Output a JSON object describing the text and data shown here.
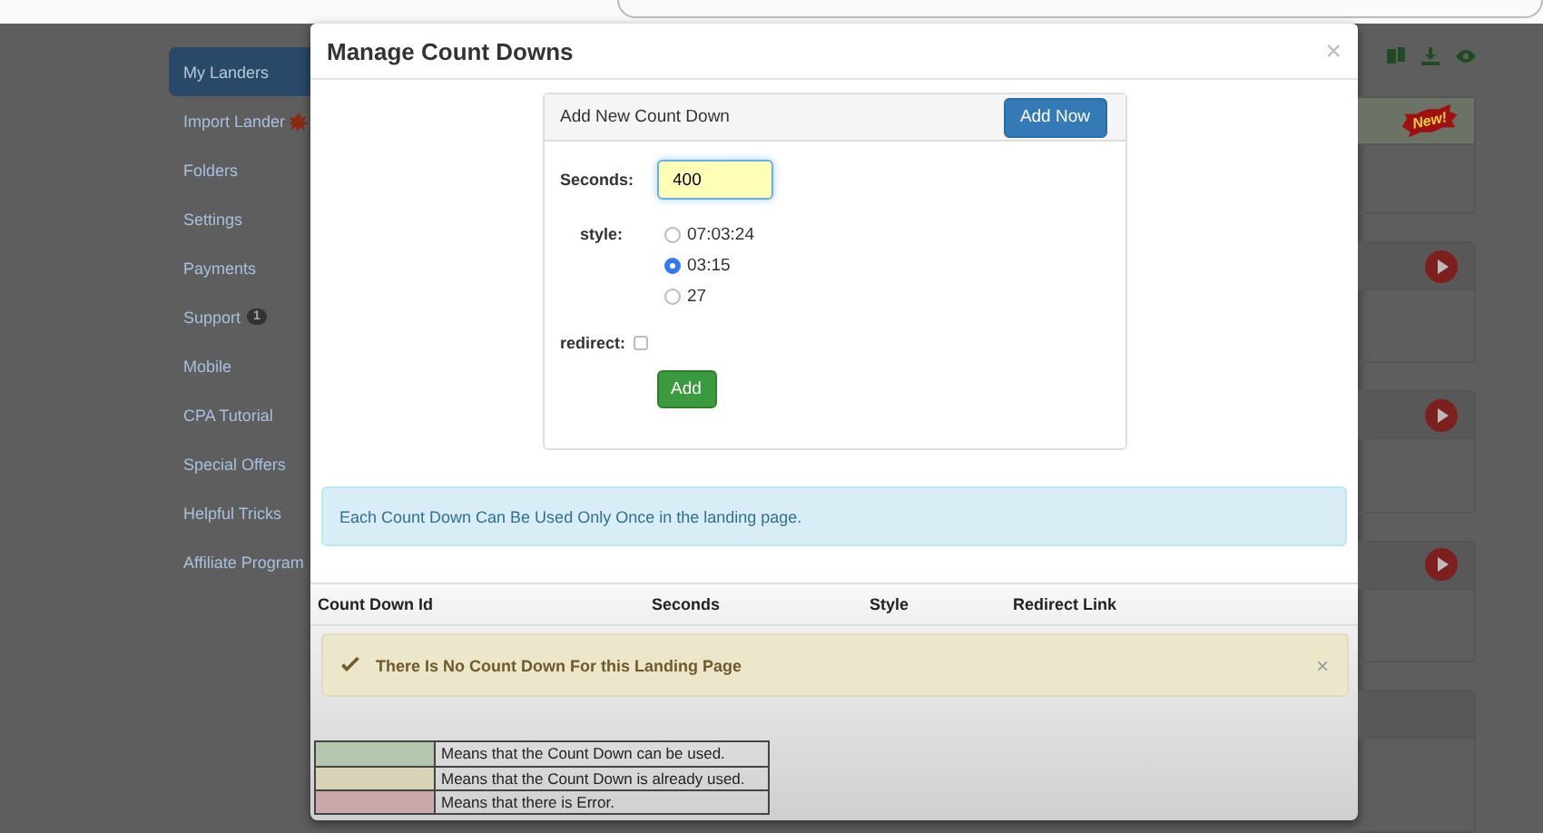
{
  "sidebar": {
    "items": [
      {
        "label": "My Landers",
        "selected": true
      },
      {
        "label": "Import Lander",
        "selected": false,
        "kind": "new"
      },
      {
        "label": "Folders",
        "selected": false
      },
      {
        "label": "Settings",
        "selected": false
      },
      {
        "label": "Payments",
        "selected": false
      },
      {
        "label": "Support",
        "selected": false,
        "badge": "1"
      },
      {
        "label": "Mobile",
        "selected": false
      },
      {
        "label": "CPA Tutorial",
        "selected": false
      },
      {
        "label": "Special Offers",
        "selected": false
      },
      {
        "label": "Helpful Tricks",
        "selected": false
      },
      {
        "label": "Affiliate Program",
        "selected": false
      }
    ]
  },
  "modal": {
    "title": "Manage Count Downs",
    "close": "×",
    "panel": {
      "title": "Add New Count Down",
      "add_now": "Add Now",
      "seconds_label": "Seconds:",
      "seconds_value": "400",
      "style_label": "style:",
      "styles": [
        {
          "label": "07:03:24",
          "selected": false
        },
        {
          "label": "03:15",
          "selected": true
        },
        {
          "label": "27",
          "selected": false
        }
      ],
      "redirect_label": "redirect:",
      "redirect_checked": false,
      "add_button": "Add"
    },
    "info": "Each Count Down Can Be Used Only Once in the landing page.",
    "table": {
      "columns": [
        "Count Down Id",
        "Seconds",
        "Style",
        "Redirect Link"
      ]
    },
    "empty_message": "There Is No Count Down For this Landing Page",
    "empty_close": "×",
    "legend": [
      {
        "color": "#b4c6ae",
        "text": "Means that the Count Down can be used."
      },
      {
        "color": "#d8d2b7",
        "text": "Means that the Count Down is already used."
      },
      {
        "color": "#c8a8aa",
        "text": "Means that there is Error."
      }
    ]
  },
  "background": {
    "badge": "New!",
    "cards": [
      {
        "kind": "new"
      },
      {
        "kind": "play"
      },
      {
        "kind": "play"
      },
      {
        "kind": "play"
      },
      {
        "kind": "plain"
      }
    ]
  }
}
